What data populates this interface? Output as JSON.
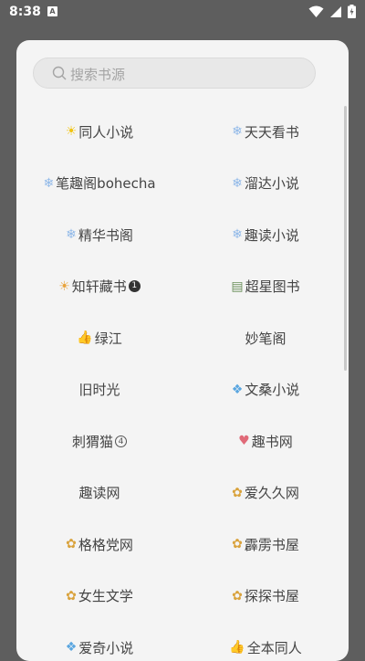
{
  "status_bar": {
    "time": "8:38",
    "notification_letter": "A",
    "battery_icon": "battery-charging-icon",
    "wifi_icon": "wifi-icon",
    "signal_icon": "cell-signal-icon"
  },
  "search": {
    "placeholder": "搜索书源"
  },
  "sources": [
    {
      "icon": "☀",
      "icon_name": "sun-icon",
      "icon_color": "#f1c40f",
      "label": "同人小说"
    },
    {
      "icon": "❄",
      "icon_name": "snowflake-icon",
      "icon_color": "#8fb8e8",
      "label": "天天看书"
    },
    {
      "icon": "❄",
      "icon_name": "snowflake-icon",
      "icon_color": "#8fb8e8",
      "label": "笔趣阁bohecha"
    },
    {
      "icon": "❄",
      "icon_name": "snowflake-icon",
      "icon_color": "#8fb8e8",
      "label": "溜达小说"
    },
    {
      "icon": "❄",
      "icon_name": "snowflake-icon",
      "icon_color": "#8fb8e8",
      "label": "精华书阁"
    },
    {
      "icon": "❄",
      "icon_name": "snowflake-icon",
      "icon_color": "#8fb8e8",
      "label": "趣读小说"
    },
    {
      "icon": "☀",
      "icon_name": "sun-icon",
      "icon_color": "#e8a33c",
      "label": "知轩藏书",
      "badge": "1"
    },
    {
      "icon": "▤",
      "icon_name": "books-icon",
      "icon_color": "#6a8f5a",
      "label": "超星图书"
    },
    {
      "icon": "👍",
      "icon_name": "thumbs-up-icon",
      "icon_color": "#e8b13c",
      "label": "绿江"
    },
    {
      "icon": "",
      "icon_name": "",
      "icon_color": "",
      "label": "妙笔阁"
    },
    {
      "icon": "",
      "icon_name": "",
      "icon_color": "",
      "label": "旧时光"
    },
    {
      "icon": "❖",
      "icon_name": "diamond-icon",
      "icon_color": "#5aa6e0",
      "label": "文桑小说"
    },
    {
      "icon": "",
      "icon_name": "",
      "icon_color": "",
      "label": "刺猬猫",
      "circled": "4"
    },
    {
      "icon": "♥",
      "icon_name": "heart-icon",
      "icon_color": "#e06a78",
      "label": "趣书网"
    },
    {
      "icon": "",
      "icon_name": "",
      "icon_color": "",
      "label": "趣读网"
    },
    {
      "icon": "✿",
      "icon_name": "bouquet-icon",
      "icon_color": "#d9a23c",
      "label": "爱久久网"
    },
    {
      "icon": "✿",
      "icon_name": "bouquet-icon",
      "icon_color": "#d9a23c",
      "label": "格格党网"
    },
    {
      "icon": "✿",
      "icon_name": "bouquet-icon",
      "icon_color": "#d9a23c",
      "label": "霹雳书屋"
    },
    {
      "icon": "✿",
      "icon_name": "bouquet-icon",
      "icon_color": "#d9a23c",
      "label": "女生文学"
    },
    {
      "icon": "✿",
      "icon_name": "bouquet-icon",
      "icon_color": "#d9a23c",
      "label": "探探书屋"
    },
    {
      "icon": "❖",
      "icon_name": "diamond-icon",
      "icon_color": "#5aa6e0",
      "label": "爱奇小说"
    },
    {
      "icon": "👍",
      "icon_name": "thumbs-up-icon",
      "icon_color": "#e8b13c",
      "label": "全本同人"
    }
  ]
}
